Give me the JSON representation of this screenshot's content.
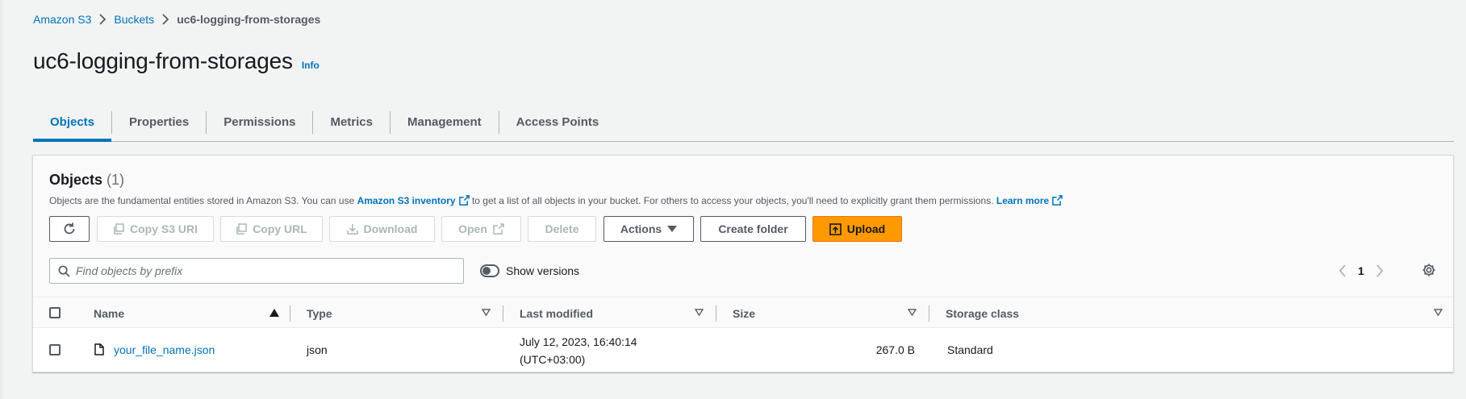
{
  "breadcrumb": {
    "items": [
      "Amazon S3",
      "Buckets"
    ],
    "current": "uc6-logging-from-storages"
  },
  "header": {
    "title": "uc6-logging-from-storages",
    "info": "Info"
  },
  "tabs": [
    {
      "label": "Objects",
      "active": true
    },
    {
      "label": "Properties"
    },
    {
      "label": "Permissions"
    },
    {
      "label": "Metrics"
    },
    {
      "label": "Management"
    },
    {
      "label": "Access Points"
    }
  ],
  "objects_panel": {
    "title": "Objects",
    "count": "(1)",
    "description_pre": "Objects are the fundamental entities stored in Amazon S3. You can use ",
    "inventory_link": "Amazon S3 inventory",
    "description_mid": " to get a list of all objects in your bucket. For others to access your objects, you'll need to explicitly grant them permissions. ",
    "learn_more": "Learn more"
  },
  "toolbar": {
    "copy_s3_uri": "Copy S3 URI",
    "copy_url": "Copy URL",
    "download": "Download",
    "open": "Open",
    "delete": "Delete",
    "actions": "Actions",
    "create_folder": "Create folder",
    "upload": "Upload"
  },
  "search": {
    "placeholder": "Find objects by prefix",
    "value": ""
  },
  "show_versions": {
    "label": "Show versions",
    "on": false
  },
  "pagination": {
    "page": "1"
  },
  "table": {
    "columns": [
      "Name",
      "Type",
      "Last modified",
      "Size",
      "Storage class"
    ],
    "rows": [
      {
        "name": "your_file_name.json",
        "type": "json",
        "last_modified_date": "July 12, 2023, 16:40:14",
        "last_modified_tz": "(UTC+03:00)",
        "size": "267.0 B",
        "storage_class": "Standard"
      }
    ]
  },
  "colors": {
    "link": "#0073bb",
    "primary": "#ff9900",
    "text": "#16191f",
    "muted": "#545b64"
  }
}
